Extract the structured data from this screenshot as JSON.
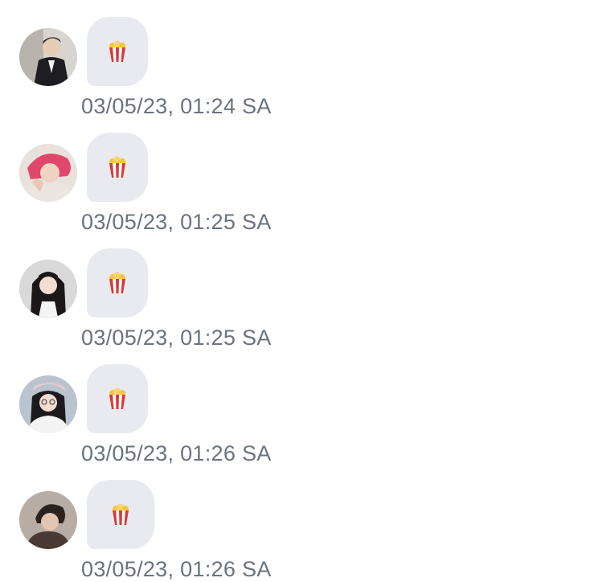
{
  "messages": [
    {
      "timestamp": "03/05/23, 01:24 SA",
      "emoji": "popcorn-icon",
      "avatar": "avatar-1"
    },
    {
      "timestamp": "03/05/23, 01:25 SA",
      "emoji": "popcorn-icon",
      "avatar": "avatar-2"
    },
    {
      "timestamp": "03/05/23, 01:25 SA",
      "emoji": "popcorn-icon",
      "avatar": "avatar-3"
    },
    {
      "timestamp": "03/05/23, 01:26 SA",
      "emoji": "popcorn-icon",
      "avatar": "avatar-4"
    },
    {
      "timestamp": "03/05/23, 01:26 SA",
      "emoji": "popcorn-icon",
      "avatar": "avatar-5"
    }
  ],
  "colors": {
    "bubble": "#e9eaef",
    "timestamp": "#6b7280",
    "popcorn_red": "#d9383a",
    "popcorn_yellow": "#f6c544"
  }
}
